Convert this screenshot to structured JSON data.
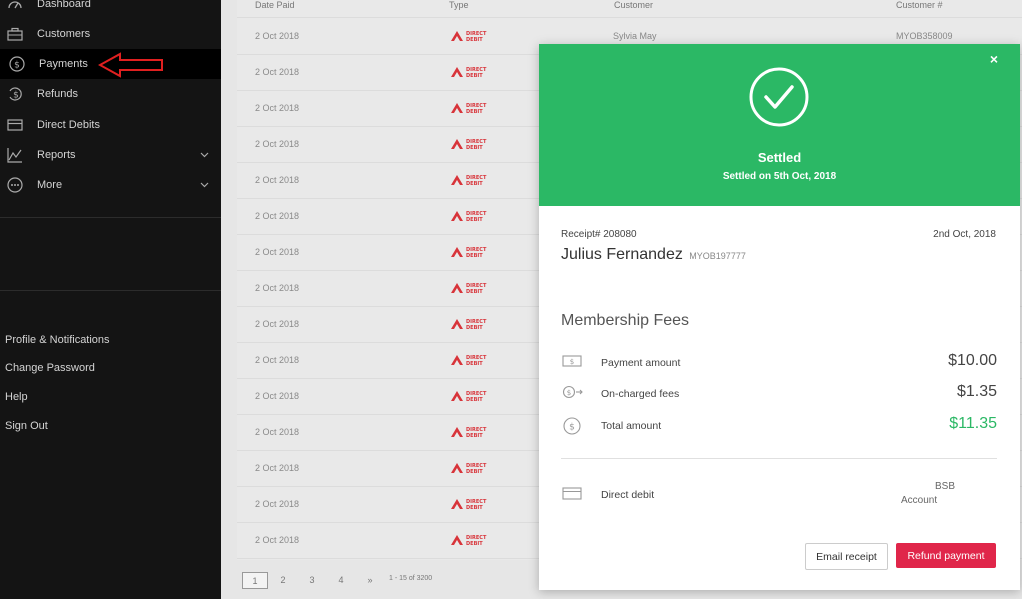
{
  "sidebar": {
    "items": [
      {
        "label": "Dashboard",
        "icon": "dashboard-icon"
      },
      {
        "label": "Customers",
        "icon": "briefcase-icon"
      },
      {
        "label": "Payments",
        "icon": "dollar-circle-icon"
      },
      {
        "label": "Refunds",
        "icon": "refund-icon"
      },
      {
        "label": "Direct Debits",
        "icon": "card-icon"
      },
      {
        "label": "Reports",
        "icon": "chart-icon"
      },
      {
        "label": "More",
        "icon": "more-icon"
      }
    ],
    "links": [
      "Profile & Notifications",
      "Change Password",
      "Help",
      "Sign Out"
    ]
  },
  "table": {
    "headers": [
      "Date Paid",
      "Type",
      "Customer",
      "Customer #"
    ],
    "first_row": {
      "customer": "Sylvia May",
      "customer_no": "MYOB358009"
    },
    "row_date": "2 Oct 2018",
    "type_logo_text": "DIRECT DEBIT",
    "pager": {
      "pages": [
        "1",
        "2",
        "3",
        "4"
      ],
      "next": "»",
      "summary": "1 - 15 of 3200"
    }
  },
  "modal": {
    "close": "×",
    "status": "Settled",
    "status_sub": "Settled on 5th Oct, 2018",
    "receipt": "Receipt# 208080",
    "date": "2nd Oct, 2018",
    "customer_name": "Julius Fernandez",
    "customer_no": "MYOB197777",
    "section": "Membership Fees",
    "lines": [
      {
        "label": "Payment amount",
        "value": "$10.00"
      },
      {
        "label": "On-charged fees",
        "value": "$1.35"
      },
      {
        "label": "Total amount",
        "value": "$11.35"
      }
    ],
    "method": "Direct debit",
    "bsb": "BSB",
    "account": "Account",
    "email_btn": "Email receipt",
    "refund_btn": "Refund payment"
  },
  "colors": {
    "accent_green": "#2bb865",
    "refund_red": "#e0264a",
    "annotation_arrow": "#e02020"
  }
}
